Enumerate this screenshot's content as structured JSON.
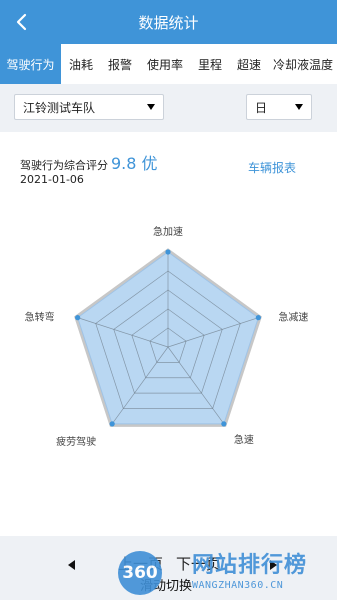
{
  "header": {
    "title": "数据统计",
    "back_icon": "chevron-left-icon"
  },
  "tabs": [
    {
      "label": "驾驶行为",
      "active": true
    },
    {
      "label": "油耗"
    },
    {
      "label": "报警"
    },
    {
      "label": "使用率"
    },
    {
      "label": "里程"
    },
    {
      "label": "超速"
    },
    {
      "label": "冷却液温度"
    }
  ],
  "filters": {
    "fleet": "江铃测试车队",
    "period": "日"
  },
  "summary": {
    "label": "驾驶行为综合评分",
    "score": "9.8 优",
    "date": "2021-01-06",
    "report_link": "车辆报表"
  },
  "radar": {
    "axes": [
      "急加速",
      "急减速",
      "急速",
      "疲劳驾驶",
      "急转弯"
    ],
    "values": [
      1.0,
      1.0,
      1.0,
      1.0,
      1.0
    ],
    "max": 1.0,
    "fill_color": "#b9d7f2",
    "line_color": "#3f94d8"
  },
  "pager": {
    "prev": "上一页",
    "next": "下一页",
    "sub": "滑动切换"
  },
  "watermark": {
    "badge": "360",
    "text": "网站排行榜",
    "url": "WANGZHAN360.CN"
  },
  "colors": {
    "accent": "#3f94d8",
    "background": "#eef1f5"
  }
}
